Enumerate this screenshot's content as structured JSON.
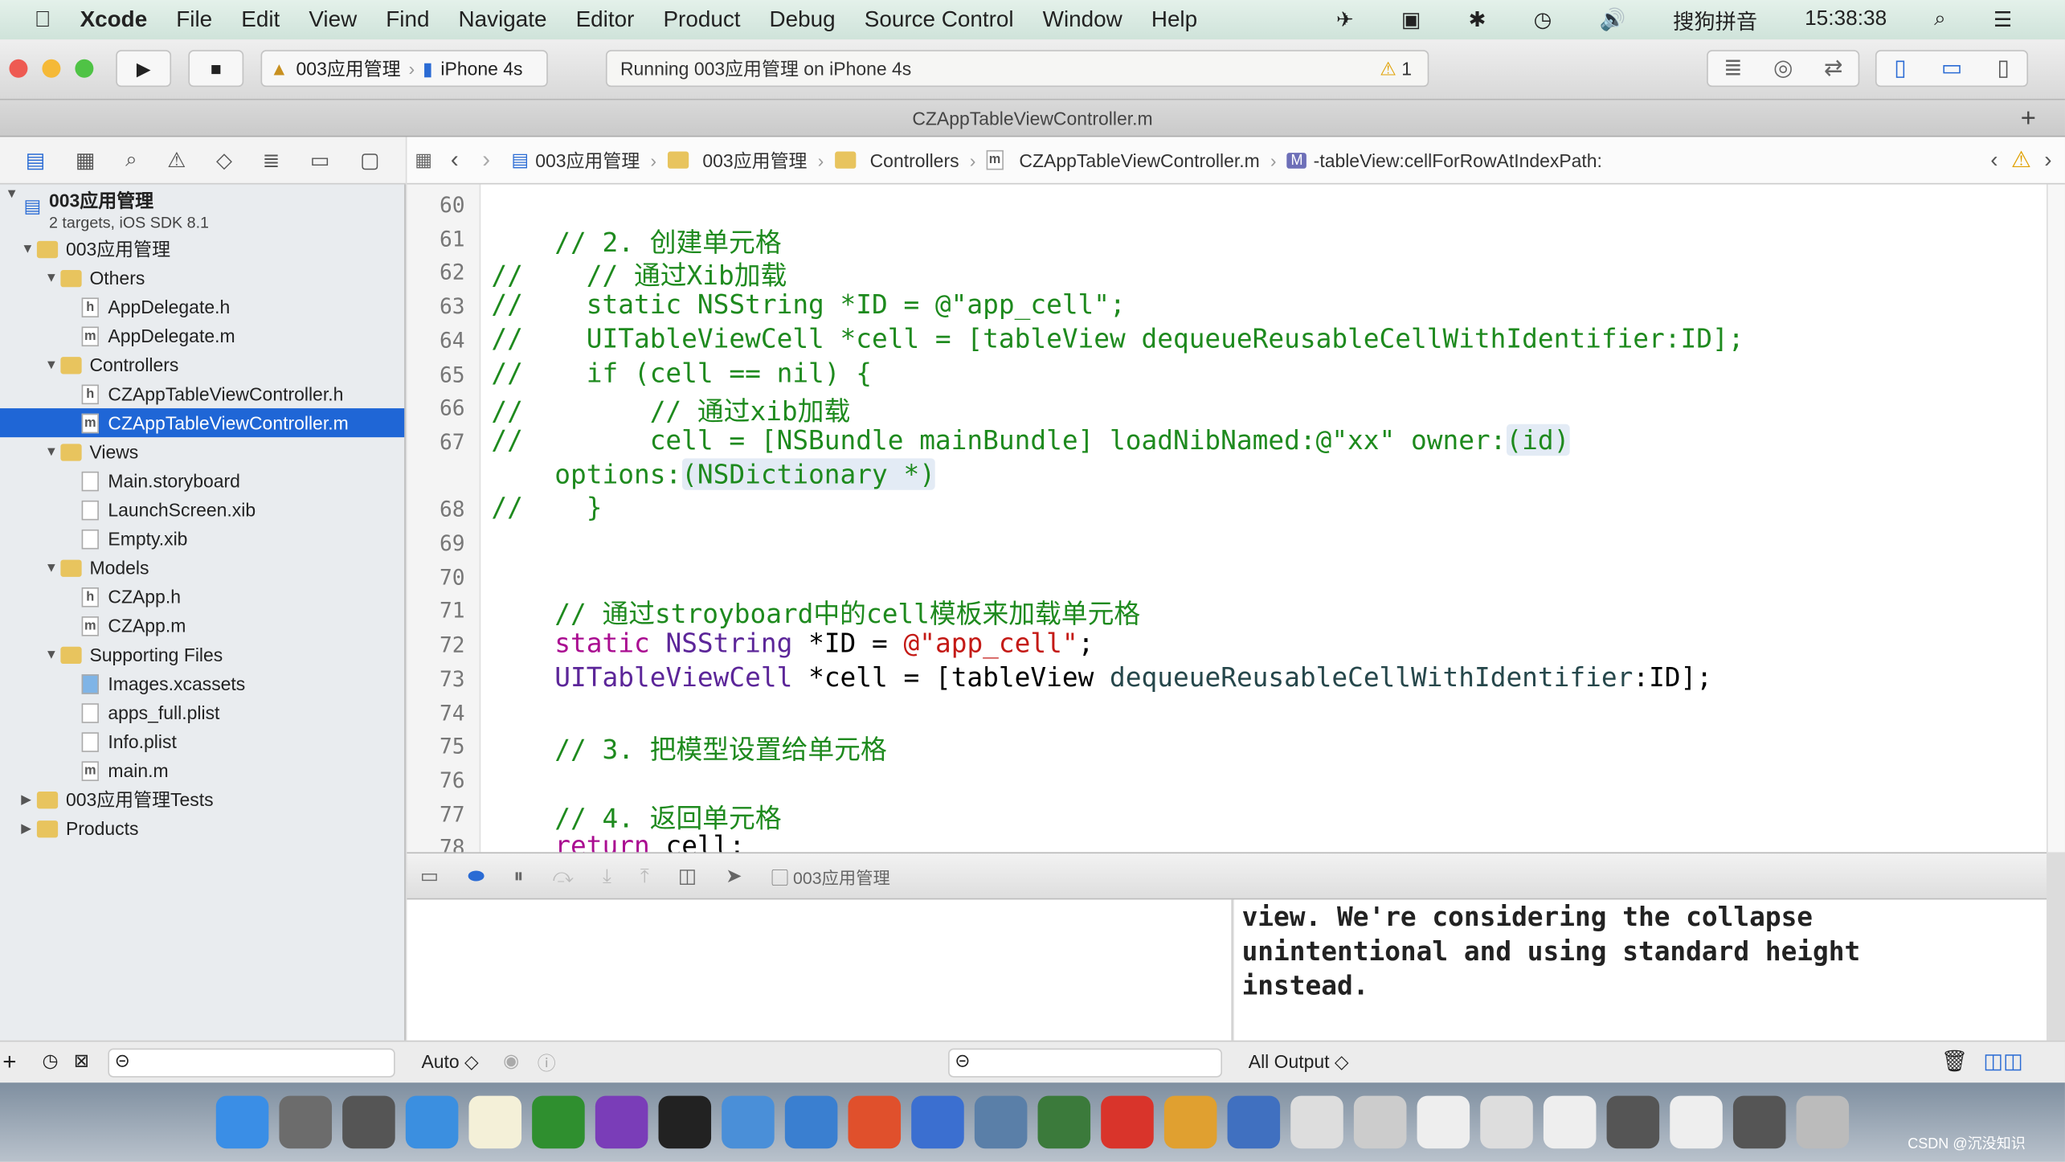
{
  "menubar": {
    "items": [
      "Xcode",
      "File",
      "Edit",
      "View",
      "Find",
      "Navigate",
      "Editor",
      "Product",
      "Debug",
      "Source Control",
      "Window",
      "Help"
    ],
    "input_method": "搜狗拼音",
    "time": "15:38:38"
  },
  "toolbar": {
    "scheme": "003应用管理",
    "device": "iPhone 4s",
    "status": "Running 003应用管理 on iPhone 4s",
    "warning_count": "1",
    "colors": {
      "close": "#ee5a52",
      "minimize": "#f5b937",
      "zoom": "#4fc345"
    }
  },
  "tab": {
    "title": "CZAppTableViewController.m",
    "add": "+"
  },
  "jumpbar": {
    "items": [
      "003应用管理",
      "003应用管理",
      "Controllers",
      "CZAppTableViewController.m",
      "-tableView:cellForRowAtIndexPath:"
    ]
  },
  "navigator": {
    "project": {
      "name": "003应用管理",
      "subtitle": "2 targets, iOS SDK 8.1"
    },
    "items": [
      {
        "label": "003应用管理",
        "type": "folder",
        "depth": 1,
        "open": true
      },
      {
        "label": "Others",
        "type": "folder",
        "depth": 2,
        "open": true
      },
      {
        "label": "AppDelegate.h",
        "type": "h",
        "depth": 3
      },
      {
        "label": "AppDelegate.m",
        "type": "m",
        "depth": 3
      },
      {
        "label": "Controllers",
        "type": "folder",
        "depth": 2,
        "open": true
      },
      {
        "label": "CZAppTableViewController.h",
        "type": "h",
        "depth": 3
      },
      {
        "label": "CZAppTableViewController.m",
        "type": "m",
        "depth": 3,
        "selected": true
      },
      {
        "label": "Views",
        "type": "folder",
        "depth": 2,
        "open": true
      },
      {
        "label": "Main.storyboard",
        "type": "sb",
        "depth": 3
      },
      {
        "label": "LaunchScreen.xib",
        "type": "xib",
        "depth": 3
      },
      {
        "label": "Empty.xib",
        "type": "xib",
        "depth": 3
      },
      {
        "label": "Models",
        "type": "folder",
        "depth": 2,
        "open": true
      },
      {
        "label": "CZApp.h",
        "type": "h",
        "depth": 3
      },
      {
        "label": "CZApp.m",
        "type": "m",
        "depth": 3
      },
      {
        "label": "Supporting Files",
        "type": "folder",
        "depth": 2,
        "open": true
      },
      {
        "label": "Images.xcassets",
        "type": "assets",
        "depth": 3
      },
      {
        "label": "apps_full.plist",
        "type": "plist",
        "depth": 3
      },
      {
        "label": "Info.plist",
        "type": "plist",
        "depth": 3
      },
      {
        "label": "main.m",
        "type": "m",
        "depth": 3
      },
      {
        "label": "003应用管理Tests",
        "type": "folder",
        "depth": 1,
        "open": false
      },
      {
        "label": "Products",
        "type": "folder",
        "depth": 1,
        "open": false
      }
    ]
  },
  "code": [
    {
      "n": "60",
      "html": ""
    },
    {
      "n": "61",
      "html": "<span class='cm'>    // 2. 创建单元格</span>"
    },
    {
      "n": "62",
      "html": "<span class='cm'>//    // 通过Xib加载</span>"
    },
    {
      "n": "63",
      "html": "<span class='cm'>//    static NSString *ID = @\"app_cell\";</span>"
    },
    {
      "n": "64",
      "html": "<span class='cm'>//    UITableViewCell *cell = [tableView dequeueReusableCellWithIdentifier:ID];</span>"
    },
    {
      "n": "65",
      "html": "<span class='cm'>//    if (cell == nil) {</span>"
    },
    {
      "n": "66",
      "html": "<span class='cm'>//        // 通过xib加载</span>"
    },
    {
      "n": "67",
      "html": "<span class='cm'>//        cell = [NSBundle mainBundle] loadNibNamed:@\"xx\" owner:<span class='hl'>(id)</span></span>"
    },
    {
      "n": "",
      "html": "<span class='cm'>    options:<span class='hl'>(NSDictionary *)</span></span>"
    },
    {
      "n": "68",
      "html": "<span class='cm'>//    }</span>"
    },
    {
      "n": "69",
      "html": ""
    },
    {
      "n": "70",
      "html": ""
    },
    {
      "n": "71",
      "html": "<span class='cm'>    // 通过stroyboard中的cell模板来加载单元格</span>"
    },
    {
      "n": "72",
      "html": "    <span class='kw'>static</span> <span class='ty'>NSString</span> *ID = <span class='st'>@\"app_cell\"</span>;"
    },
    {
      "n": "73",
      "html": "    <span class='ty'>UITableViewCell</span> *cell = [tableView <span class='me'>dequeueReusableCellWithIdentifier</span>:ID];"
    },
    {
      "n": "74",
      "html": ""
    },
    {
      "n": "75",
      "html": "<span class='cm'>    // 3. 把模型设置给单元格</span>"
    },
    {
      "n": "76",
      "html": ""
    },
    {
      "n": "77",
      "html": "<span class='cm'>    // 4. 返回单元格</span>"
    },
    {
      "n": "78",
      "html": "    <span class='kw'>return</span> cell;"
    }
  ],
  "debugbar": {
    "target": "003应用管理"
  },
  "console": {
    "text": "view. We're considering the collapse\nunintentional and using standard height\ninstead."
  },
  "bottom": {
    "auto": "Auto ◇",
    "output": "All Output ◇"
  },
  "watermark": "CSDN @沉没知识"
}
